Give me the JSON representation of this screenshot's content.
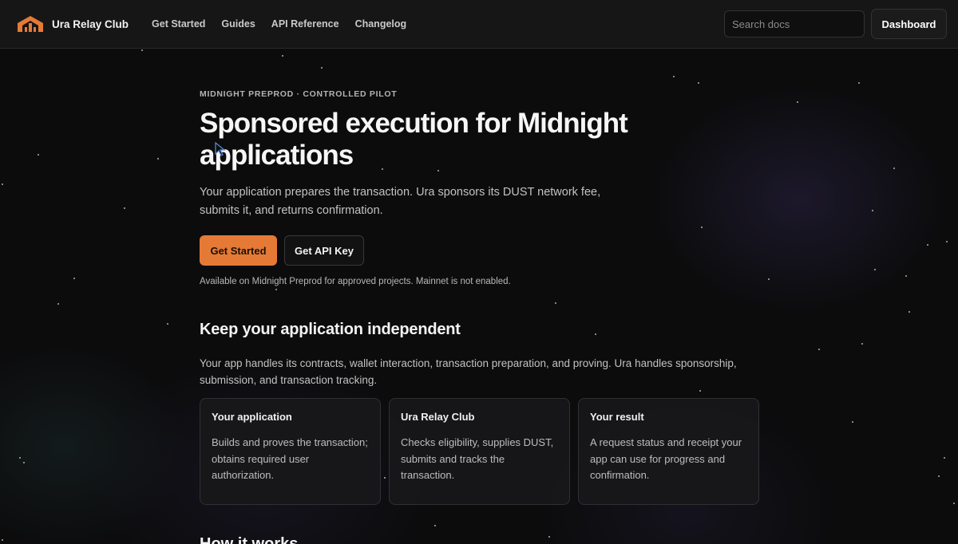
{
  "header": {
    "brand": "Ura Relay Club",
    "nav": [
      "Get Started",
      "Guides",
      "API Reference",
      "Changelog"
    ],
    "search_placeholder": "Search docs",
    "dashboard_label": "Dashboard"
  },
  "hero": {
    "eyebrow": "MIDNIGHT PREPROD · CONTROLLED PILOT",
    "title": "Sponsored execution for Midnight applications",
    "subtitle": "Your application prepares the transaction. Ura sponsors its DUST network fee, submits it, and returns confirmation.",
    "primary_cta": "Get Started",
    "secondary_cta": "Get API Key",
    "availability": "Available on Midnight Preprod for approved projects. Mainnet is not enabled."
  },
  "independent": {
    "title": "Keep your application independent",
    "body": "Your app handles its contracts, wallet interaction, transaction preparation, and proving. Ura handles sponsorship, submission, and transaction tracking.",
    "cards": [
      {
        "title": "Your application",
        "body": "Builds and proves the transaction; obtains required user authorization."
      },
      {
        "title": "Ura Relay Club",
        "body": "Checks eligibility, supplies DUST, submits and tracks the transaction."
      },
      {
        "title": "Your result",
        "body": "A request status and receipt your app can use for progress and confirmation."
      }
    ]
  },
  "next_section": {
    "title": "How it works"
  },
  "icons": {
    "logo": "ura-logo-icon",
    "cursor": "mouse-cursor-icon"
  },
  "colors": {
    "accent": "#e57a37",
    "background": "#0c0c0d",
    "header_bg": "#161617"
  }
}
